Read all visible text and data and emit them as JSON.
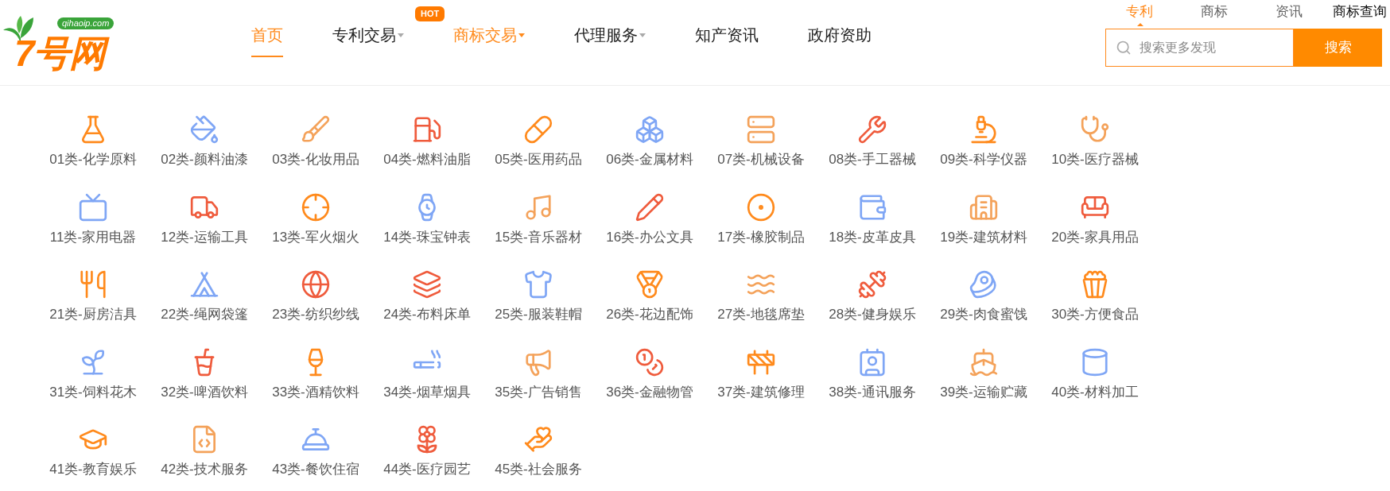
{
  "logo": {
    "name": "7号网",
    "domain": "qihaoip.com"
  },
  "nav": [
    {
      "label": "首页",
      "selected": true,
      "dropdown": false
    },
    {
      "label": "专利交易",
      "selected": false,
      "dropdown": true,
      "badge": "HOT"
    },
    {
      "label": "商标交易",
      "selected": false,
      "hovered": true,
      "dropdown": true
    },
    {
      "label": "代理服务",
      "selected": false,
      "dropdown": true
    },
    {
      "label": "知产资讯",
      "selected": false,
      "dropdown": false
    },
    {
      "label": "政府资助",
      "selected": false,
      "dropdown": false
    }
  ],
  "search_tabs": [
    {
      "label": "专利",
      "selected": true,
      "kind": "tab"
    },
    {
      "label": "商标",
      "selected": false,
      "kind": "tab"
    },
    {
      "label": "资讯",
      "selected": false,
      "kind": "tab"
    },
    {
      "label": "商标查询",
      "selected": false,
      "kind": "link"
    }
  ],
  "search": {
    "placeholder": "搜索更多发现",
    "button": "搜索"
  },
  "categories": [
    {
      "label": "01类-化学原料",
      "color": "#ff8a1c"
    },
    {
      "label": "02类-颜料油漆",
      "color": "#7fa6f5"
    },
    {
      "label": "03类-化妆用品",
      "color": "#f4a25a"
    },
    {
      "label": "04类-燃料油脂",
      "color": "#ef5b3c"
    },
    {
      "label": "05类-医用药品",
      "color": "#ff8a1c"
    },
    {
      "label": "06类-金属材料",
      "color": "#7fa6f5"
    },
    {
      "label": "07类-机械设备",
      "color": "#f4a25a"
    },
    {
      "label": "08类-手工器械",
      "color": "#ef5b3c"
    },
    {
      "label": "09类-科学仪器",
      "color": "#ff8a1c"
    },
    {
      "label": "10类-医疗器械",
      "color": "#f4a25a"
    },
    {
      "label": "11类-家用电器",
      "color": "#7fa6f5"
    },
    {
      "label": "12类-运输工具",
      "color": "#ef5b3c"
    },
    {
      "label": "13类-军火烟火",
      "color": "#ff8a1c"
    },
    {
      "label": "14类-珠宝钟表",
      "color": "#7fa6f5"
    },
    {
      "label": "15类-音乐器材",
      "color": "#f4a25a"
    },
    {
      "label": "16类-办公文具",
      "color": "#ef5b3c"
    },
    {
      "label": "17类-橡胶制品",
      "color": "#ff8a1c"
    },
    {
      "label": "18类-皮革皮具",
      "color": "#7fa6f5"
    },
    {
      "label": "19类-建筑材料",
      "color": "#f4a25a"
    },
    {
      "label": "20类-家具用品",
      "color": "#ef5b3c"
    },
    {
      "label": "21类-厨房洁具",
      "color": "#ff8a1c"
    },
    {
      "label": "22类-绳网袋篷",
      "color": "#7fa6f5"
    },
    {
      "label": "23类-纺织纱线",
      "color": "#ef5b3c"
    },
    {
      "label": "24类-布料床单",
      "color": "#ef5b3c"
    },
    {
      "label": "25类-服装鞋帽",
      "color": "#7fa6f5"
    },
    {
      "label": "26类-花边配饰",
      "color": "#ff8a1c"
    },
    {
      "label": "27类-地毯席垫",
      "color": "#f4a25a"
    },
    {
      "label": "28类-健身娱乐",
      "color": "#ef5b3c"
    },
    {
      "label": "29类-肉食蜜饯",
      "color": "#7fa6f5"
    },
    {
      "label": "30类-方便食品",
      "color": "#ff8a1c"
    },
    {
      "label": "31类-饲料花木",
      "color": "#7fa6f5"
    },
    {
      "label": "32类-啤酒饮料",
      "color": "#ef5b3c"
    },
    {
      "label": "33类-酒精饮料",
      "color": "#ff8a1c"
    },
    {
      "label": "34类-烟草烟具",
      "color": "#7fa6f5"
    },
    {
      "label": "35类-广告销售",
      "color": "#f4a25a"
    },
    {
      "label": "36类-金融物管",
      "color": "#ef5b3c"
    },
    {
      "label": "37类-建筑修理",
      "color": "#ff8a1c"
    },
    {
      "label": "38类-通讯服务",
      "color": "#7fa6f5"
    },
    {
      "label": "39类-运输贮藏",
      "color": "#f4a25a"
    },
    {
      "label": "40类-材料加工",
      "color": "#7fa6f5"
    },
    {
      "label": "41类-教育娱乐",
      "color": "#ff8a1c"
    },
    {
      "label": "42类-技术服务",
      "color": "#f4a25a"
    },
    {
      "label": "43类-餐饮住宿",
      "color": "#7fa6f5"
    },
    {
      "label": "44类-医疗园艺",
      "color": "#ef5b3c"
    },
    {
      "label": "45类-社会服务",
      "color": "#ff8a1c"
    }
  ]
}
